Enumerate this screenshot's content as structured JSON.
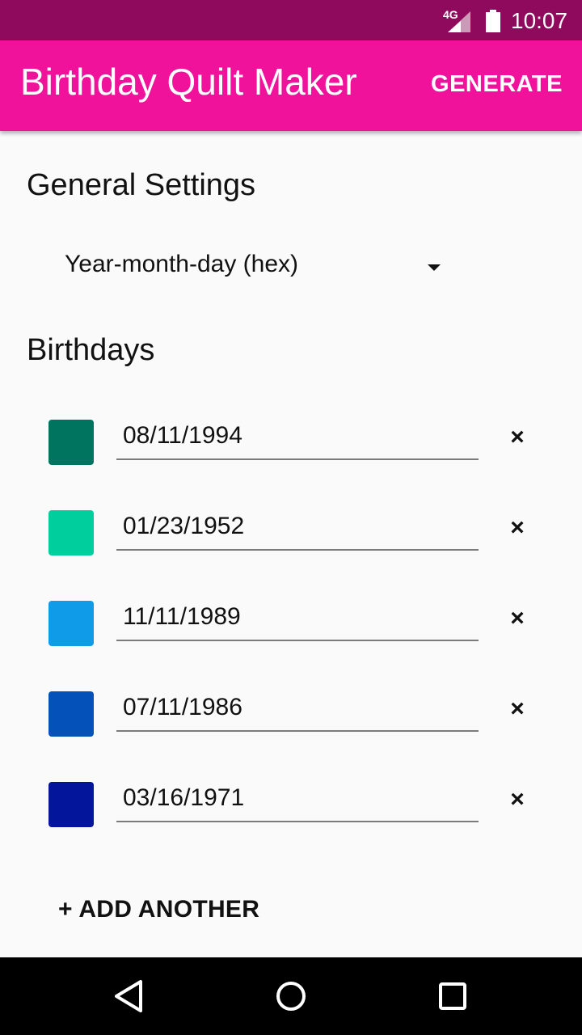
{
  "status_bar": {
    "network": "4G",
    "time": "10:07",
    "icons": [
      "signal-icon",
      "battery-icon"
    ]
  },
  "app_bar": {
    "title": "Birthday Quilt Maker",
    "action": "GENERATE"
  },
  "general_settings": {
    "heading": "General Settings",
    "format_selected": "Year-month-day (hex)"
  },
  "birthdays": {
    "heading": "Birthdays",
    "items": [
      {
        "date": "08/11/1994",
        "color": "#00745f"
      },
      {
        "date": "01/23/1952",
        "color": "#00cf9d"
      },
      {
        "date": "11/11/1989",
        "color": "#109be8"
      },
      {
        "date": "07/11/1986",
        "color": "#0351b9"
      },
      {
        "date": "03/16/1971",
        "color": "#03169b"
      }
    ],
    "remove_label": "×",
    "add_label": "+ ADD ANOTHER"
  },
  "nav_bar": {
    "icons": [
      "back-icon",
      "home-icon",
      "recents-icon"
    ]
  }
}
